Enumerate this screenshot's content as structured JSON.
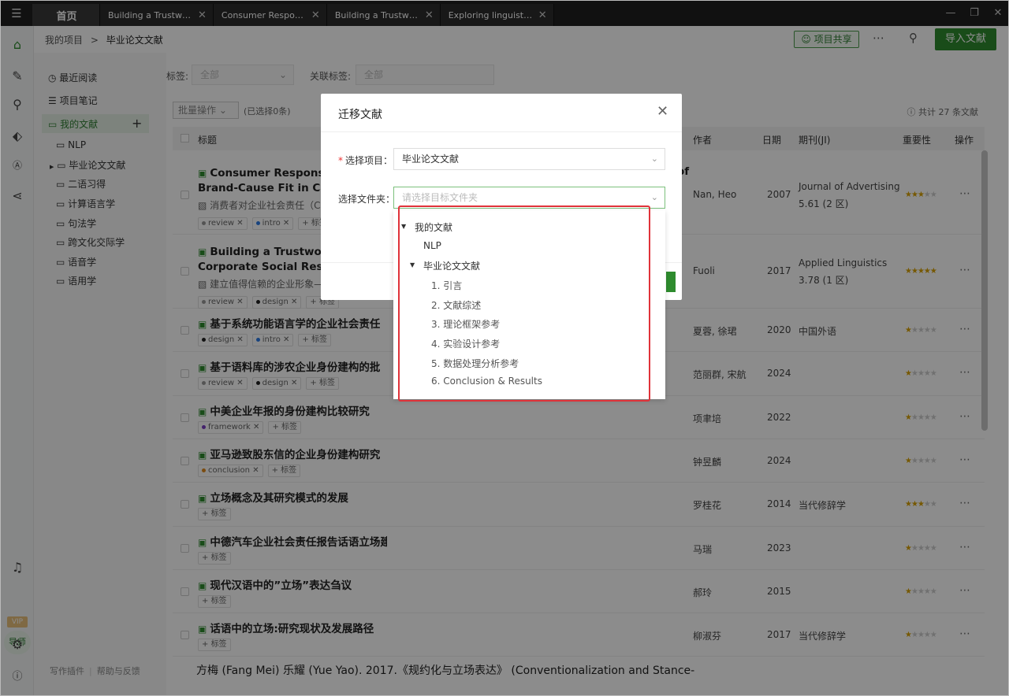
{
  "tabs": [
    {
      "label": "首页"
    },
    {
      "label": "Building a Trustworth..."
    },
    {
      "label": "Consumer Responses..."
    },
    {
      "label": "Building a Trustworth..."
    },
    {
      "label": "Exploring linguistic a..."
    }
  ],
  "header": {
    "breadcrumb_root": "我的项目",
    "breadcrumb_sep": ">",
    "breadcrumb_current": "毕业论文文献",
    "share_label": "项目共享",
    "import_label": "导入文献"
  },
  "rail": {
    "vip": "VIP",
    "mentor": "导师"
  },
  "sidebar": {
    "recent": "最近阅读",
    "notes": "项目笔记",
    "mine": "我的文献",
    "folders": [
      "NLP",
      "毕业论文文献",
      "二语习得",
      "计算语言学",
      "句法学",
      "跨文化交际学",
      "语音学",
      "语用学"
    ],
    "footer_plugin": "写作插件",
    "footer_help": "帮助与反馈"
  },
  "filters": {
    "tag_label": "标签:",
    "tag_value": "全部",
    "related_label": "关联标签:",
    "related_value": "全部"
  },
  "toolbar": {
    "bulk": "批量操作",
    "selected": "(已选择0条)",
    "total": "共计 27 条文献"
  },
  "table": {
    "columns": {
      "title": "标题",
      "author": "作者",
      "date": "日期",
      "journal": "期刊(JI)",
      "importance": "重要性",
      "ops": "操作"
    },
    "rows": [
      {
        "title": "Consumer Responses",
        "title2": "Brand-Cause Fit in Cause",
        "sub": "消费者对企业社会责任（C",
        "author": "Nan, Heo",
        "date": "2007",
        "journal": "Journal of Advertising",
        "journal2": "5.61 (2 区)",
        "tags": [
          "review",
          "intro"
        ],
        "stars": 3
      },
      {
        "title": "Building a Trustworthy",
        "title2": "Corporate Social Respons",
        "sub": "建立值得信赖的企业形象—",
        "author": "Fuoli",
        "date": "2017",
        "journal": "Applied Linguistics",
        "journal2": "3.78 (1 区)",
        "tags": [
          "review",
          "design"
        ],
        "stars": 5
      },
      {
        "title": "基于系统功能语言学的企业社会责任",
        "author": "夏蓉, 徐珺",
        "date": "2020",
        "journal": "中国外语",
        "tags": [
          "design",
          "intro"
        ],
        "stars": 1
      },
      {
        "title": "基于语料库的涉农企业身份建构的批",
        "author": "范丽群, 宋航",
        "date": "2024",
        "journal": "",
        "tags": [
          "review",
          "design"
        ],
        "stars": 1
      },
      {
        "title": "中美企业年报的身份建构比较研究",
        "author": "项聿培",
        "date": "2022",
        "journal": "",
        "tags": [
          "framework"
        ],
        "stars": 1
      },
      {
        "title": "亚马逊致股东信的企业身份建构研究",
        "author": "钟昱麟",
        "date": "2024",
        "journal": "",
        "tags": [
          "conclusion"
        ],
        "stars": 1
      },
      {
        "title": "立场概念及其研究模式的发展",
        "author": "罗桂花",
        "date": "2014",
        "journal": "当代修辞学",
        "tags": [],
        "stars": 3
      },
      {
        "title": "中德汽车企业社会责任报告话语立场建构对比研究",
        "author": "马瑞",
        "date": "2023",
        "journal": "",
        "tags": [],
        "stars": 1
      },
      {
        "title": "现代汉语中的”立场”表达刍议",
        "author": "郝玲",
        "date": "2015",
        "journal": "",
        "tags": [],
        "stars": 1
      },
      {
        "title": "话语中的立场:研究现状及发展路径",
        "author": "柳淑芬",
        "date": "2017",
        "journal": "当代修辞学",
        "tags": [],
        "stars": 1
      }
    ],
    "add_tag": "标签",
    "last_line": "方梅 (Fang Mei) 乐耀 (Yue Yao). 2017.《规约化与立场表达》 (Conventionalization and Stance-",
    "title_overflow_of": "of"
  },
  "dialog": {
    "title": "迁移文献",
    "project_label": "选择项目：",
    "project_value": "毕业论文文献",
    "folder_label": "选择文件夹：",
    "folder_placeholder": "请选择目标文件夹"
  },
  "tree": {
    "root": "我的文献",
    "nlp": "NLP",
    "thesis": "毕业论文文献",
    "children": [
      "1. 引言",
      "2. 文献综述",
      "3. 理论框架参考",
      "4. 实验设计参考",
      "5. 数据处理分析参考",
      "6. Conclusion & Results"
    ]
  },
  "colors": {
    "accent": "#2e8b2e",
    "highlight": "#e0333a",
    "tag_dots": {
      "review": "#999999",
      "intro": "#2d7be5",
      "design": "#222222",
      "framework": "#7b3fc4",
      "conclusion": "#e08a1e"
    }
  }
}
